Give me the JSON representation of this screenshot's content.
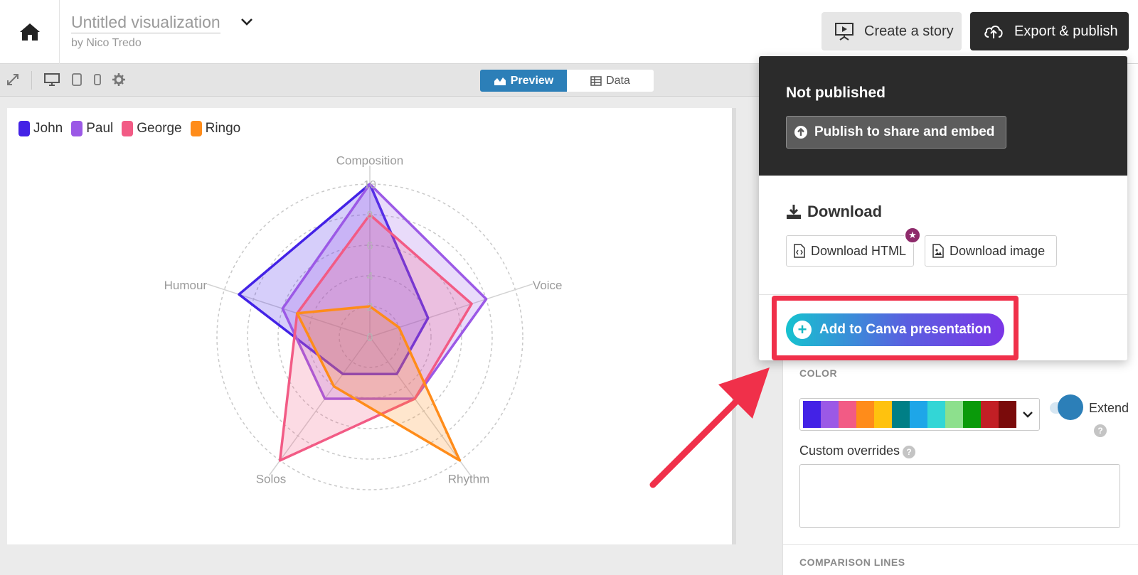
{
  "header": {
    "title": "Untitled visualization",
    "byline": "by Nico Tredo",
    "create_story": "Create a story",
    "export_publish": "Export & publish"
  },
  "toolbar": {
    "preview": "Preview",
    "data": "Data"
  },
  "dropdown": {
    "status": "Not published",
    "publish_button": "Publish to share and embed",
    "download_title": "Download",
    "download_html": "Download HTML",
    "download_image": "Download image",
    "canva_button": "Add to Canva presentation"
  },
  "panel": {
    "color_label": "COLOR",
    "palette": [
      "#4322e6",
      "#9b59e6",
      "#f25b85",
      "#ff8c1a",
      "#ffc20e",
      "#007f86",
      "#1ea6e8",
      "#33d6d6",
      "#8de08d",
      "#0a9a0a",
      "#c21f25",
      "#7a0b0b"
    ],
    "extend_label": "Extend",
    "overrides_label": "Custom overrides",
    "comparison_label": "COMPARISON LINES"
  },
  "chart_data": {
    "type": "radar",
    "axes": [
      "Composition",
      "Voice",
      "Rhythm",
      "Solos",
      "Humour"
    ],
    "rlim": [
      0,
      10
    ],
    "ticks": [
      "0",
      "2",
      "4",
      "6",
      "8",
      "10"
    ],
    "legend_position": "top-left",
    "series": [
      {
        "name": "John",
        "color": "#4322e6",
        "values": [
          10,
          4,
          3,
          3,
          9
        ]
      },
      {
        "name": "Paul",
        "color": "#9b59e6",
        "values": [
          10,
          8,
          5,
          5,
          6
        ]
      },
      {
        "name": "George",
        "color": "#f25b85",
        "values": [
          8,
          7,
          5,
          10,
          5
        ]
      },
      {
        "name": "Ringo",
        "color": "#ff8c1a",
        "values": [
          2,
          2,
          10,
          4,
          5
        ]
      }
    ]
  }
}
